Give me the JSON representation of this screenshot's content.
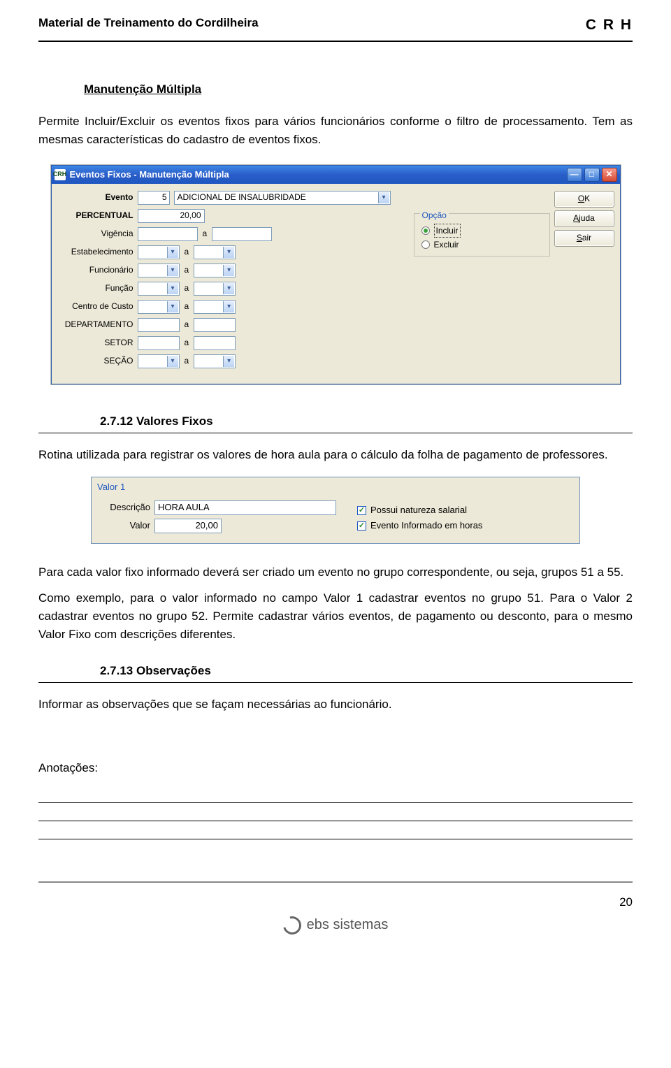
{
  "header": {
    "left": "Material de Treinamento do Cordilheira",
    "right": "C R H"
  },
  "section1": {
    "title": "Manutenção Múltipla",
    "p1": "Permite Incluir/Excluir os eventos fixos para vários funcionários conforme o filtro de processamento. Tem as mesmas características do cadastro de eventos fixos."
  },
  "dialog": {
    "app_icon": "CRH",
    "title": "Eventos Fixos - Manutenção Múltipla",
    "labels": {
      "evento": "Evento",
      "percentual": "PERCENTUAL",
      "vigencia": "Vigência",
      "estabelecimento": "Estabelecimento",
      "funcionario": "Funcionário",
      "funcao": "Função",
      "centro_custo": "Centro de Custo",
      "departamento": "DEPARTAMENTO",
      "setor": "SETOR",
      "secao": "SEÇÃO",
      "sep": "a"
    },
    "values": {
      "evento_num": "5",
      "evento_desc": "ADICIONAL DE INSALUBRIDADE",
      "percentual": "20,00"
    },
    "opcao": {
      "legend": "Opção",
      "incluir": "Incluir",
      "excluir": "Excluir"
    },
    "buttons": {
      "ok": "OK",
      "ajuda": "Ajuda",
      "sair": "Sair"
    }
  },
  "section2": {
    "heading": "2.7.12 Valores Fixos",
    "p1": "Rotina utilizada para registrar os valores de hora aula para o cálculo da folha de pagamento de professores."
  },
  "valor_panel": {
    "legend": "Valor 1",
    "descricao_label": "Descrição",
    "descricao_value": "HORA AULA",
    "valor_label": "Valor",
    "valor_value": "20,00",
    "chk1": "Possui natureza salarial",
    "chk2": "Evento Informado em horas"
  },
  "section3": {
    "p1": "Para cada valor fixo informado deverá ser criado um evento no grupo correspondente,  ou seja, grupos 51 a 55.",
    "p2": "Como exemplo, para o valor informado no campo Valor 1 cadastrar eventos no grupo 51. Para o Valor 2 cadastrar eventos no grupo 52.  Permite cadastrar vários eventos, de pagamento ou desconto, para o mesmo Valor Fixo com descrições diferentes."
  },
  "section4": {
    "heading": "2.7.13 Observações",
    "p1": "Informar as observações que se façam necessárias ao funcionário."
  },
  "notes_label": "Anotações:",
  "page_number": "20",
  "footer_brand": "ebs sistemas"
}
